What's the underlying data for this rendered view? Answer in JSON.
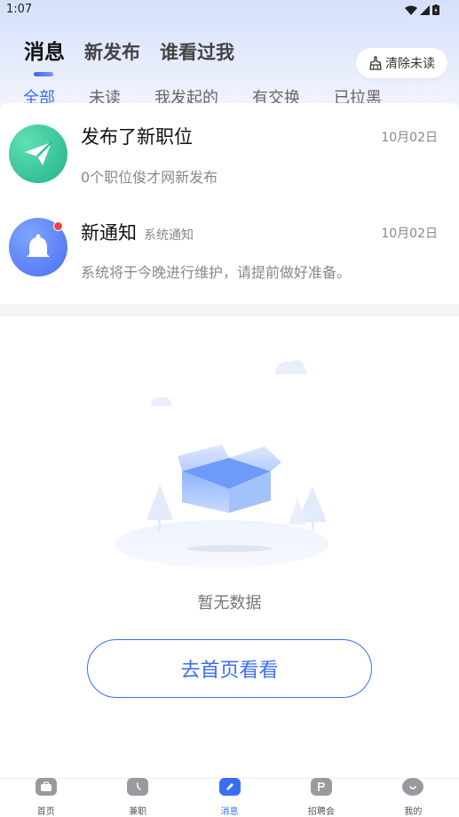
{
  "status_bar": {
    "time": "1:07"
  },
  "header": {
    "tabs": [
      {
        "label": "消息"
      },
      {
        "label": "新发布"
      },
      {
        "label": "谁看过我"
      }
    ],
    "clear_button_label": "清除未读"
  },
  "filter_tabs": [
    {
      "label": "全部"
    },
    {
      "label": "未读"
    },
    {
      "label": "我发起的"
    },
    {
      "label": "有交换"
    },
    {
      "label": "已拉黑"
    }
  ],
  "messages": [
    {
      "title": "发布了新职位",
      "tag": "",
      "date": "10月02日",
      "preview": "0个职位俊才网新发布",
      "icon": "paper-plane-icon",
      "color": "#2dbf94",
      "unread": false
    },
    {
      "title": "新通知",
      "tag": "系统通知",
      "date": "10月02日",
      "preview": "系统将于今晚进行维护，请提前做好准备。",
      "icon": "bell-icon",
      "color": "#5578f5",
      "unread": true
    }
  ],
  "empty_state": {
    "text": "暂无数据",
    "button_label": "去首页看看"
  },
  "bottom_nav": [
    {
      "label": "首页",
      "icon": "briefcase-icon"
    },
    {
      "label": "兼职",
      "icon": "clock-icon"
    },
    {
      "label": "消息",
      "icon": "message-edit-icon",
      "active": true
    },
    {
      "label": "招聘会",
      "icon": "p-flag-icon"
    },
    {
      "label": "我的",
      "icon": "smile-face-icon"
    }
  ],
  "colors": {
    "accent": "#3a6ef2",
    "unread_dot": "#f5424a"
  }
}
